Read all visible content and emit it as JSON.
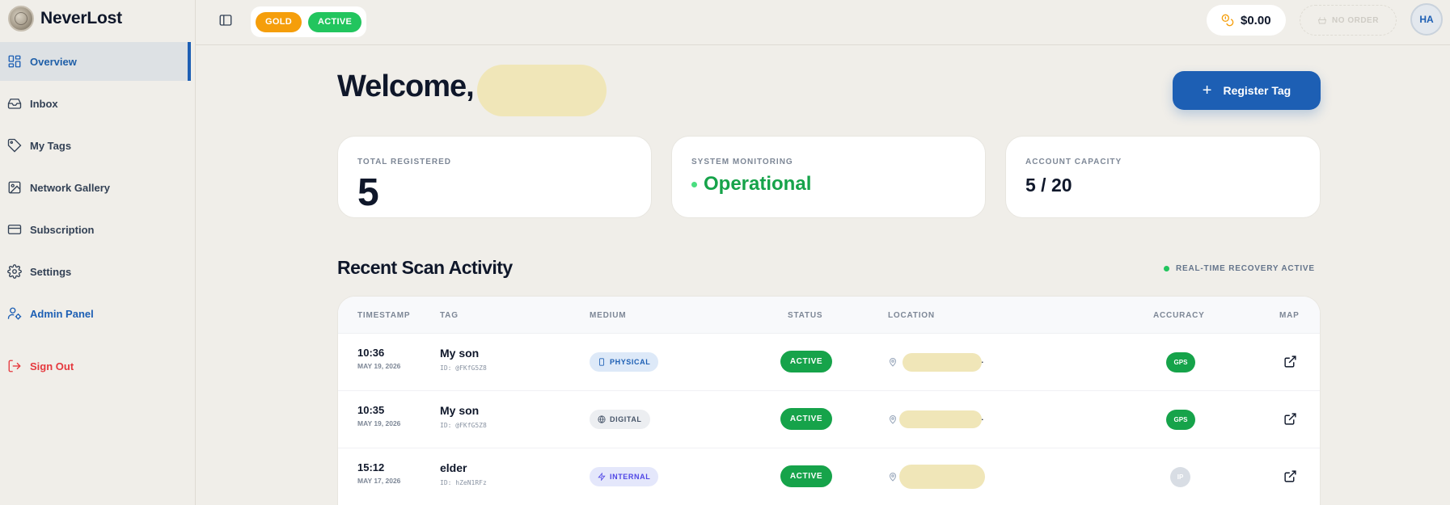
{
  "app": {
    "name": "NeverLost"
  },
  "sidebar": {
    "items": [
      {
        "label": "Overview",
        "icon": "grid-icon"
      },
      {
        "label": "Inbox",
        "icon": "inbox-icon"
      },
      {
        "label": "My Tags",
        "icon": "tag-icon"
      },
      {
        "label": "Network Gallery",
        "icon": "image-icon"
      },
      {
        "label": "Subscription",
        "icon": "credit-card-icon"
      },
      {
        "label": "Settings",
        "icon": "gear-icon"
      },
      {
        "label": "Admin Panel",
        "icon": "user-cog-icon"
      }
    ],
    "sign_out": "Sign Out"
  },
  "header": {
    "tier_badge": "GOLD",
    "status_badge": "ACTIVE",
    "balance": "$0.00",
    "order_label": "NO ORDER",
    "user_initials": "HA"
  },
  "main": {
    "welcome": "Welcome,",
    "register_button": "Register Tag",
    "stats": {
      "total_registered": {
        "label": "TOTAL REGISTERED",
        "value": "5"
      },
      "system_monitoring": {
        "label": "SYSTEM MONITORING",
        "value": "Operational"
      },
      "account_capacity": {
        "label": "ACCOUNT CAPACITY",
        "value": "5 / 20"
      }
    },
    "activity": {
      "title": "Recent Scan Activity",
      "realtime_label": "REAL-TIME RECOVERY ACTIVE",
      "columns": {
        "timestamp": "TIMESTAMP",
        "tag": "TAG",
        "medium": "MEDIUM",
        "status": "STATUS",
        "location": "LOCATION",
        "accuracy": "ACCURACY",
        "map": "MAP"
      },
      "rows": [
        {
          "time": "10:36",
          "date": "MAY 19, 2026",
          "tag": "My son",
          "tag_id": "ID: @FKfG5Z8",
          "medium": "PHYSICAL",
          "status": "ACTIVE",
          "accuracy": "GPS"
        },
        {
          "time": "10:35",
          "date": "MAY 19, 2026",
          "tag": "My son",
          "tag_id": "ID: @FKfG5Z8",
          "medium": "DIGITAL",
          "status": "ACTIVE",
          "accuracy": "GPS"
        },
        {
          "time": "15:12",
          "date": "MAY 17, 2026",
          "tag": "elder",
          "tag_id": "ID: hZeN1RFz",
          "medium": "INTERNAL",
          "status": "ACTIVE",
          "accuracy": "IP"
        }
      ]
    }
  },
  "colors": {
    "primary": "#1d5fb4",
    "success": "#16a34a",
    "gold": "#f59e0b",
    "danger": "#e5393e",
    "background": "#f0eee9"
  }
}
